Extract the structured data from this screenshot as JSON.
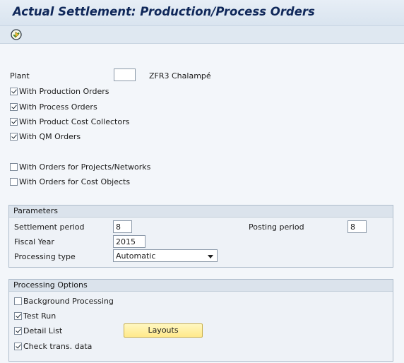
{
  "title": "Actual Settlement: Production/Process Orders",
  "toolbar": {
    "execute_icon": "execute-icon"
  },
  "selection": {
    "plant_label": "Plant",
    "plant_value": "",
    "plant_description": "ZFR3 Chalampé",
    "checkboxes": [
      {
        "label": "With Production Orders",
        "checked": true
      },
      {
        "label": "With Process Orders",
        "checked": true
      },
      {
        "label": "With Product Cost Collectors",
        "checked": true
      },
      {
        "label": "With QM Orders",
        "checked": true
      },
      {
        "label": "With Orders for Projects/Networks",
        "checked": false
      },
      {
        "label": "With Orders for Cost Objects",
        "checked": false
      }
    ]
  },
  "parameters": {
    "title": "Parameters",
    "settlement_period_label": "Settlement period",
    "settlement_period_value": "8",
    "posting_period_label": "Posting period",
    "posting_period_value": "8",
    "fiscal_year_label": "Fiscal Year",
    "fiscal_year_value": "2015",
    "processing_type_label": "Processing type",
    "processing_type_value": "Automatic"
  },
  "processing_options": {
    "title": "Processing Options",
    "background_label": "Background Processing",
    "background_checked": false,
    "test_run_label": "Test Run",
    "test_run_checked": true,
    "detail_list_label": "Detail List",
    "detail_list_checked": true,
    "check_trans_label": "Check trans. data",
    "check_trans_checked": true,
    "layouts_button": "Layouts"
  }
}
